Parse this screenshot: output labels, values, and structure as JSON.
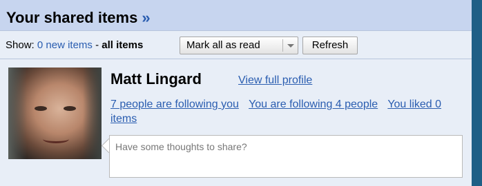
{
  "header": {
    "title": "Your shared items",
    "title_suffix": "»"
  },
  "toolbar": {
    "show_label": "Show:",
    "new_items_link": "0 new items",
    "separator": "-",
    "all_items_label": "all items",
    "mark_all_read_button": "Mark all as read",
    "refresh_button": "Refresh"
  },
  "profile": {
    "name": "Matt Lingard",
    "view_full_profile_link": "View full profile",
    "followers_link": "7 people are following you",
    "following_link": "You are following 4 people",
    "liked_link": "You liked 0 items",
    "share_placeholder": "Have some thoughts to share?"
  },
  "colors": {
    "panel_bg": "#c7d5ef",
    "toolbar_bg": "#e8eef7",
    "link": "#2a5db0",
    "accent_stripe": "#1f5f86"
  },
  "icons": {
    "mark_dropdown": "chevron-down-icon"
  }
}
